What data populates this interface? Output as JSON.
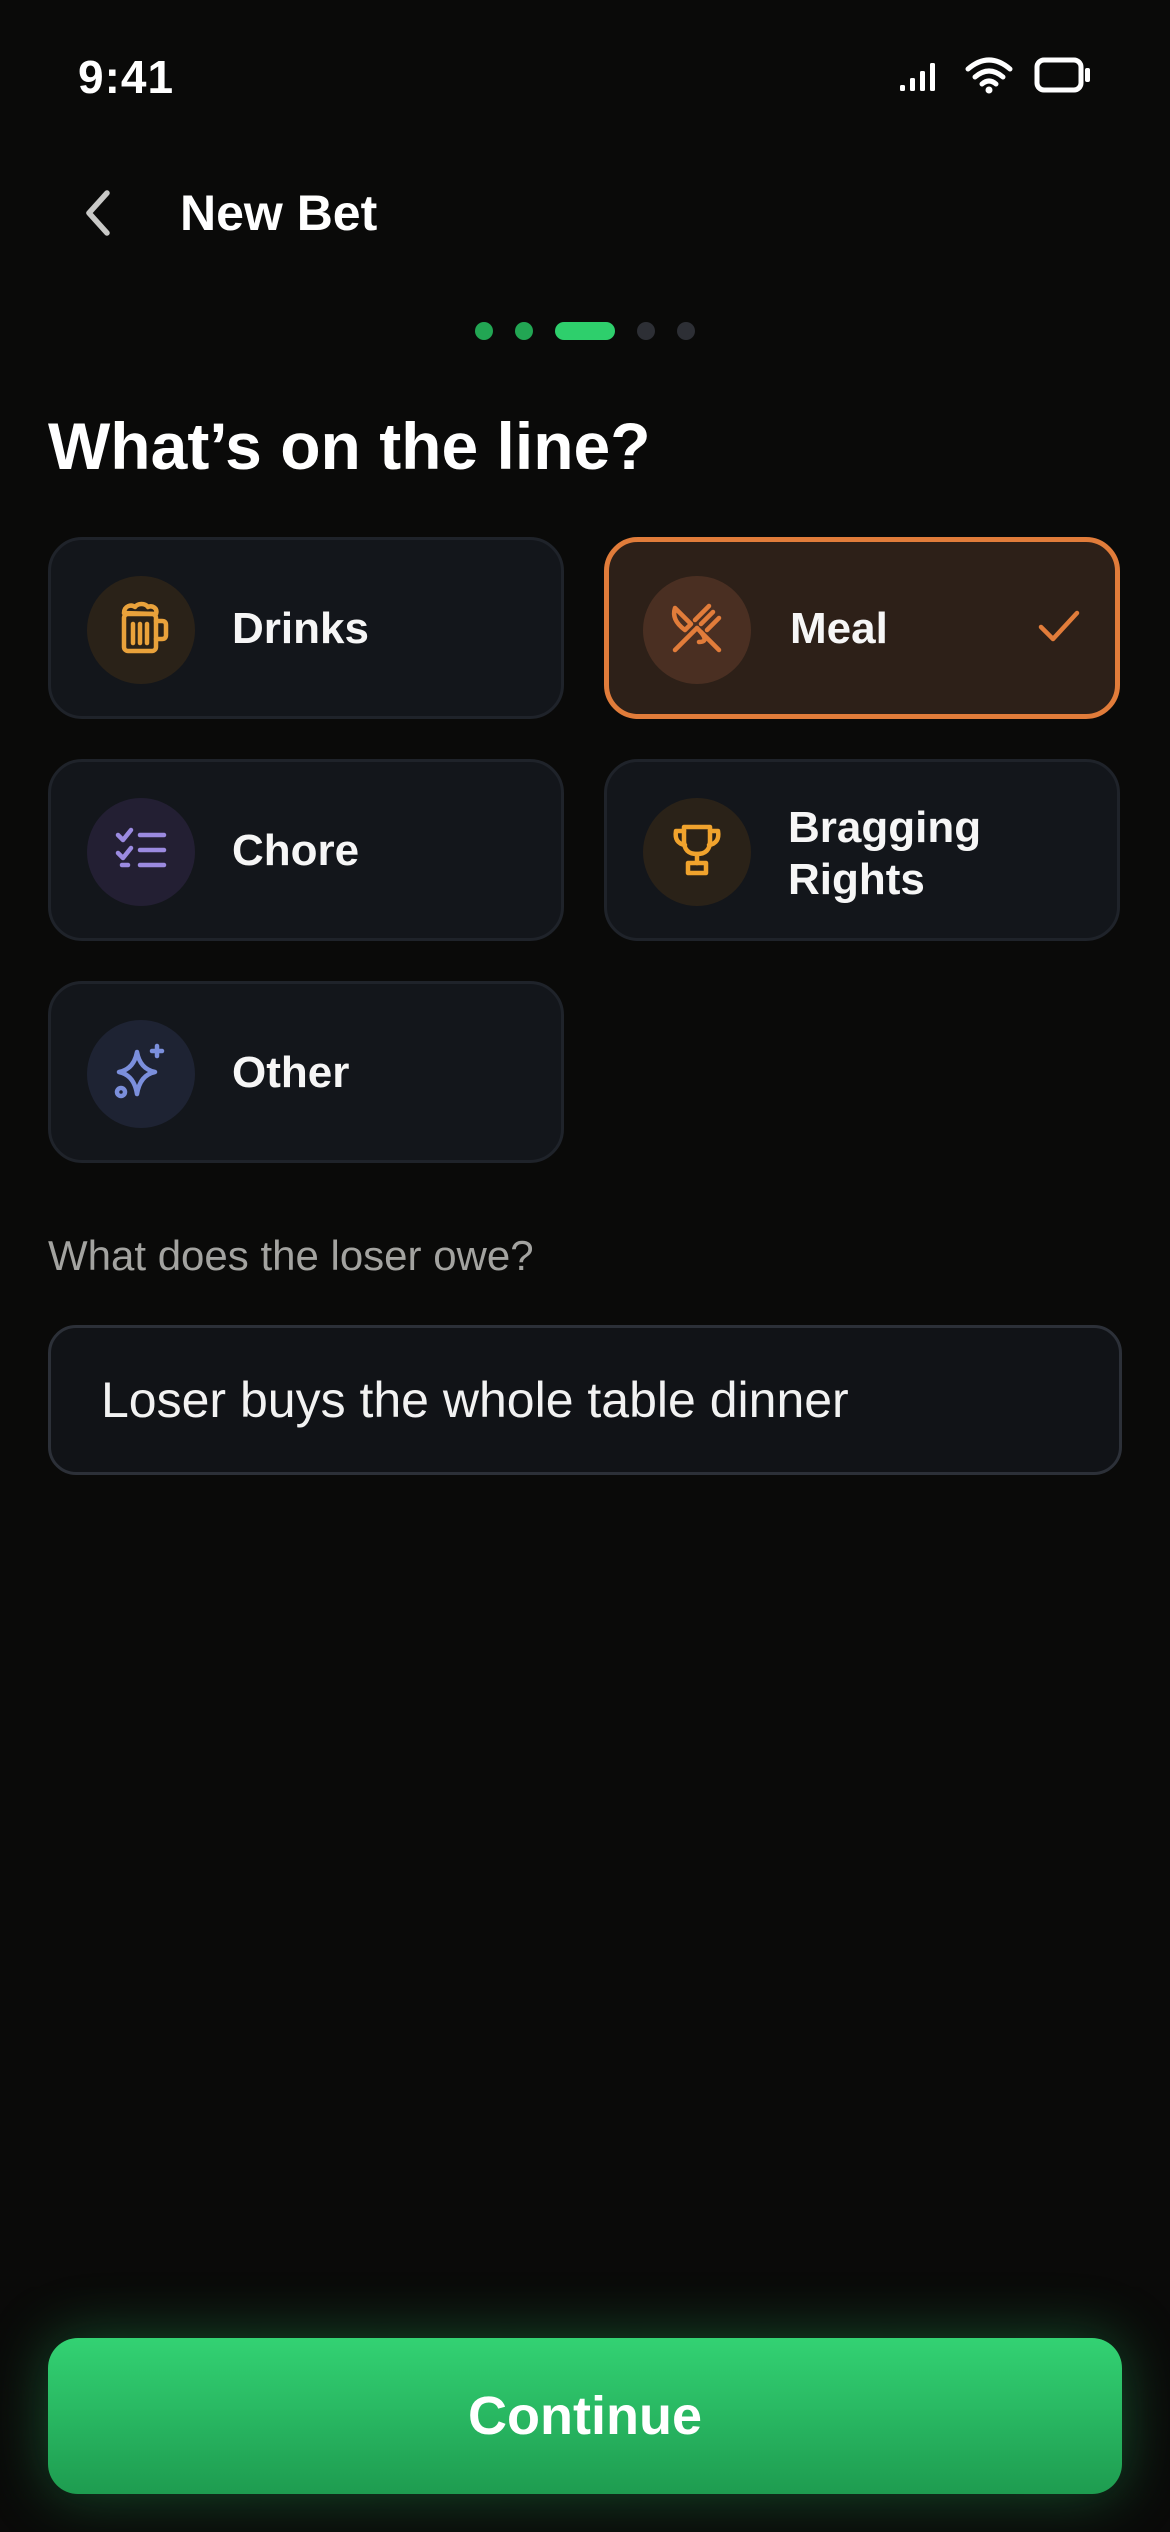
{
  "status_bar": {
    "time": "9:41",
    "icons": [
      "signal-icon",
      "wifi-icon",
      "battery-icon"
    ]
  },
  "header": {
    "back_icon": "chevron-left-icon",
    "title": "New Bet"
  },
  "progress": {
    "total_steps": 5,
    "current_step": 3
  },
  "page": {
    "title": "What’s on the line?"
  },
  "stakes": [
    {
      "id": "drinks",
      "label": "Drinks",
      "icon": "beer-mug-icon",
      "color": "#e9a23b",
      "selected": false
    },
    {
      "id": "meal",
      "label": "Meal",
      "icon": "utensils-crossed-icon",
      "color": "#e17c3a",
      "selected": true
    },
    {
      "id": "chore",
      "label": "Chore",
      "icon": "checklist-icon",
      "color": "#9b8ae0",
      "selected": false
    },
    {
      "id": "bragging",
      "label": "Bragging Rights",
      "label_line1": "Bragging",
      "label_line2": "Rights",
      "icon": "trophy-icon",
      "color": "#f0a32d",
      "selected": false
    },
    {
      "id": "other",
      "label": "Other",
      "icon": "sparkles-icon",
      "color": "#7b8fdc",
      "selected": false
    }
  ],
  "owe_field": {
    "label": "What does the loser owe?",
    "value": "Loser buys the whole table dinner"
  },
  "continue_label": "Continue",
  "colors": {
    "background": "#0a0a09",
    "accent_green": "#2ecf6c",
    "selected_orange": "#e17c3a"
  }
}
